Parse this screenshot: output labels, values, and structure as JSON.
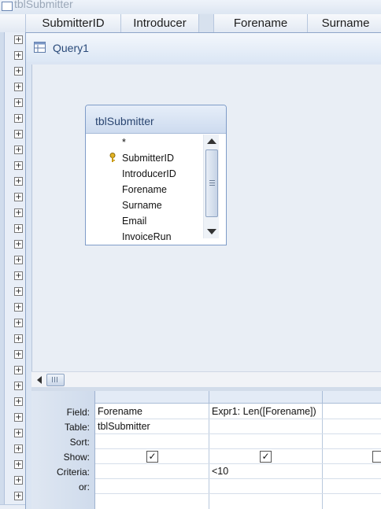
{
  "background_datasheet": {
    "title": "tblSubmitter",
    "columns": [
      "SubmitterID",
      "Introducer",
      "Forename",
      "Surname"
    ],
    "row_expander": "+"
  },
  "query_window": {
    "title": "Query1",
    "table": {
      "name": "tblSubmitter",
      "fields": [
        "*",
        "SubmitterID",
        "IntroducerID",
        "Forename",
        "Surname",
        "Email",
        "InvoiceRun"
      ],
      "primary_key_field": "SubmitterID"
    },
    "grid": {
      "labels": {
        "field": "Field:",
        "table": "Table:",
        "sort": "Sort:",
        "show": "Show:",
        "criteria": "Criteria:",
        "or": "or:"
      },
      "columns": [
        {
          "field": "Forename",
          "table": "tblSubmitter",
          "sort": "",
          "show": true,
          "criteria": "",
          "or": ""
        },
        {
          "field": "Expr1: Len([Forename])",
          "table": "",
          "sort": "",
          "show": true,
          "criteria": "<10",
          "or": ""
        },
        {
          "field": "",
          "table": "",
          "sort": "",
          "show": false,
          "criteria": "",
          "or": ""
        }
      ]
    }
  },
  "icons": {
    "table": "table-icon",
    "query": "query-icon",
    "key": "key-icon",
    "check": "check-mark"
  },
  "colors": {
    "accent": "#2a4a7a",
    "window_bg": "#dbe5f3"
  }
}
